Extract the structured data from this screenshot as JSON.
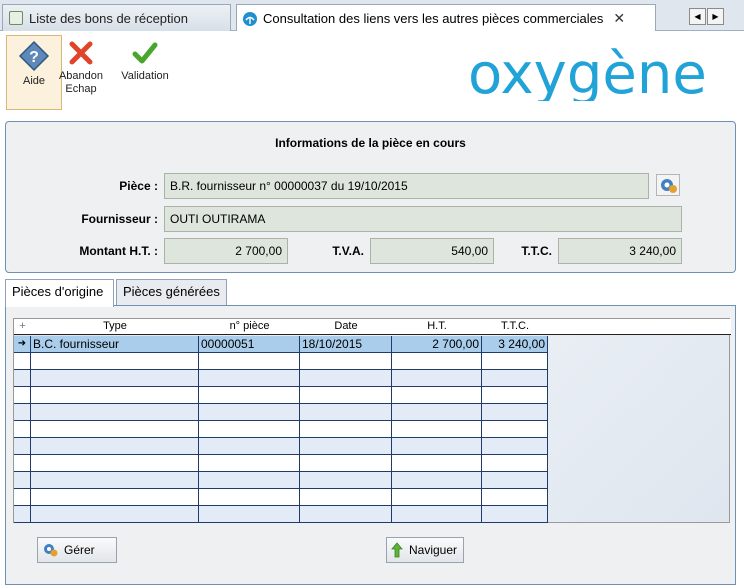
{
  "tabs": {
    "list_label": "Liste des bons de réception",
    "active_label": "Consultation des liens vers les autres pièces commerciales",
    "close": "✕"
  },
  "toolbar": {
    "help": "Aide",
    "cancel_line1": "Abandon",
    "cancel_line2": "Echap",
    "validate": "Validation"
  },
  "logo_text": "oxygène",
  "info": {
    "title": "Informations de la pièce en cours",
    "piece_label": "Pièce :",
    "piece_value": "B.R. fournisseur n° 00000037 du 19/10/2015",
    "supplier_label": "Fournisseur :",
    "supplier_value": "OUTI OUTIRAMA",
    "ht_label": "Montant H.T. :",
    "ht_value": "2 700,00",
    "tva_label": "T.V.A.",
    "tva_value": "540,00",
    "ttc_label": "T.T.C.",
    "ttc_value": "3 240,00"
  },
  "subtabs": {
    "origin": "Pièces d'origine",
    "generated": "Pièces générées"
  },
  "grid": {
    "columns": [
      "Type",
      "n° pièce",
      "Date",
      "H.T.",
      "T.T.C."
    ],
    "rows": [
      {
        "type": "B.C. fournisseur",
        "num": "00000051",
        "date": "18/10/2015",
        "ht": "2 700,00",
        "ttc": "3 240,00"
      }
    ]
  },
  "buttons": {
    "manage": "Gérer",
    "navigate": "Naviguer"
  },
  "colors": {
    "selected_row": "#a9cdea",
    "logo_blue": "#21a3d8",
    "field_bg": "#dde5dc"
  }
}
